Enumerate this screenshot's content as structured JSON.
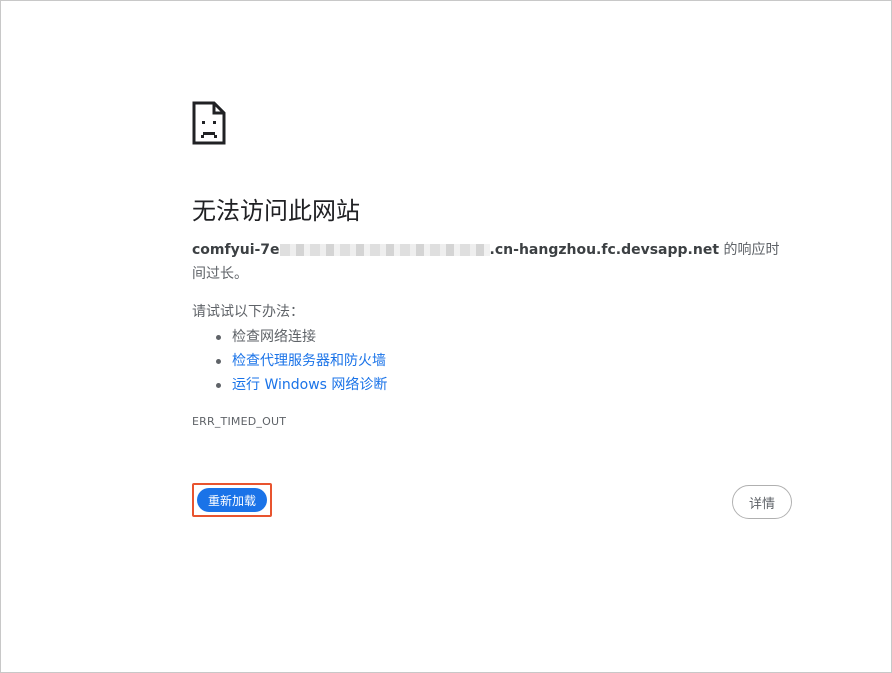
{
  "error_page": {
    "icon": "sad-page-icon",
    "title": "无法访问此网站",
    "message": {
      "host_prefix": "comfyui-7e",
      "host_suffix": ".cn-hangzhou.fc.devsapp.net",
      "text": " 的响应时间过长。"
    },
    "try_label": "请试试以下办法：",
    "suggestions": [
      {
        "label": "检查网络连接",
        "link": false
      },
      {
        "label": "检查代理服务器和防火墙",
        "link": true
      },
      {
        "label": "运行 Windows 网络诊断",
        "link": true
      }
    ],
    "error_code": "ERR_TIMED_OUT",
    "reload_label": "重新加载",
    "details_label": "详情",
    "colors": {
      "accent": "#1a73e8",
      "highlight": "#e8542f",
      "text": "#5f6368"
    }
  }
}
